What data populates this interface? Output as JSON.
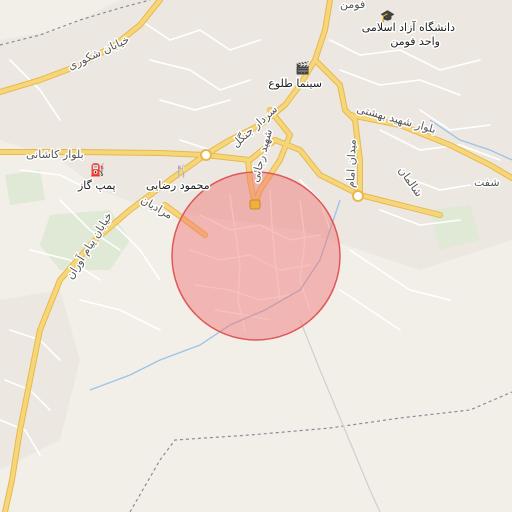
{
  "map": {
    "labels": {
      "university_line1": "دانشگاه آزاد اسلامی",
      "university_line2": "واحد فومن",
      "cinema": "سینما طلوع",
      "street_shakoori": "خیابان شکوری",
      "blvd_kashani": "بلوار کاشانی",
      "street_sardar_jangal": "سردار جنگل",
      "blvd_shahid_beheshti": "بلوار شهید بهشتی",
      "street_shahid_rajai": "شهید رجائی",
      "street_imam": "میدان امام",
      "street_shalman": "شالمان",
      "street_shaft": "شفت",
      "gas_station": "پمپ گاز",
      "mahmoud_rezaei": "محمود رضایی",
      "street_mardian": "مرادیان",
      "street_payam_avaran": "خیابان پیام آوران",
      "city_top": "فومن"
    },
    "icons": {
      "university": "graduation-cap-icon",
      "cinema": "cinema-icon",
      "gas_station": "fuel-icon",
      "restaurant": "restaurant-icon"
    },
    "colors": {
      "background": "#f2efe9",
      "major_road": "#f6d67a",
      "major_road_casing": "#e8b94a",
      "minor_road": "#ffffff",
      "water": "#9ec3e6",
      "park": "#d8e8cf",
      "boundary": "#8a8a9a",
      "circle_fill": "#f07070",
      "circle_stroke": "#e05858"
    },
    "highlight_circle": {
      "fill_opacity": 0.45
    }
  }
}
